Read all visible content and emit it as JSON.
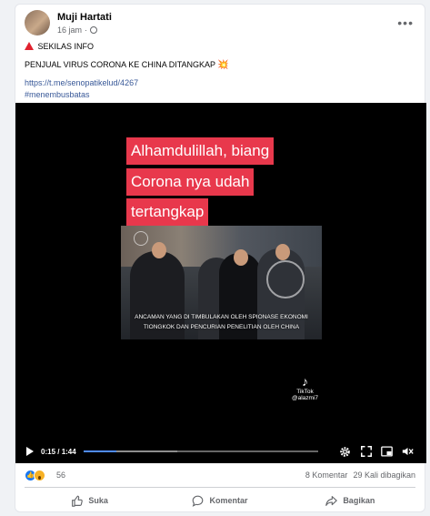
{
  "post": {
    "author": "Muji Hartati",
    "time": "16 jam",
    "separator": "·",
    "more_icon": "•••",
    "headline": "SEKILAS INFO",
    "body": "PENJUAL VIRUS CORONA KE CHINA DITANGKAP",
    "burst": "💥",
    "link": "https://t.me/senopatikelud/4267",
    "hashtag": "#menembusbatas"
  },
  "video": {
    "caption_lines": [
      "Alhamdulillah, biang",
      "Corona nya udah",
      "tertangkap"
    ],
    "subtitle_lines": [
      "ANCAMAN YANG DI TIMBULAKAN OLEH SPIONASE EKONOMI",
      "TIONGKOK DAN PENCURIAN PENELITIAN OLEH CHINA"
    ],
    "tiktok_label": "TikTok",
    "tiktok_handle": "@alazmi7",
    "tiktok_icon": "♪",
    "time_current": "0:15",
    "time_total": "1:44",
    "time_sep": " / ",
    "progress_fraction": 0.14,
    "caption_color": "#e8384c"
  },
  "stats": {
    "reactions_count": "56",
    "comments": "8 Komentar",
    "shares": "29 Kali dibagikan"
  },
  "actions": {
    "like": "Suka",
    "comment": "Komentar",
    "share": "Bagikan"
  }
}
